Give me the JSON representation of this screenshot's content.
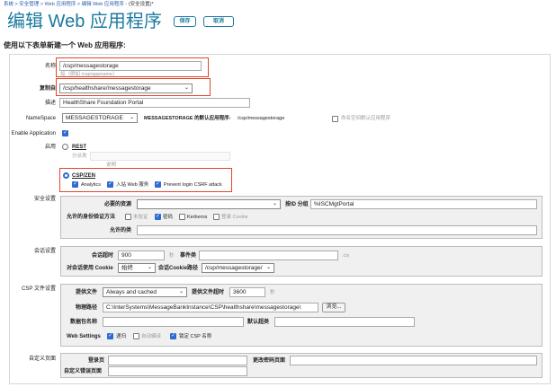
{
  "breadcrumb": {
    "items": [
      "系统",
      "安全管理",
      "Web 应用程序",
      "编辑 Web 应用程序"
    ],
    "current": "- (安全设置)*",
    "separator": ">"
  },
  "header": {
    "title": "编辑 Web 应用程序",
    "save_label": "保存",
    "cancel_label": "取消"
  },
  "subtitle": "使用以下表单新建一个 Web 应用程序:",
  "form": {
    "name_label": "名称",
    "name_value": "/csp/messagestorage",
    "name_hint": "如（例如 /csp/appname）",
    "copy_from_label": "复制自",
    "copy_from_value": "/csp/healthshare/messagestorage",
    "description_label": "描述",
    "description_value": "HealthShare Foundation Portal",
    "namespace_label": "NameSpace",
    "namespace_value": "MESSAGESTORAGE",
    "namespace_default_label": "MESSAGESTORAGE 的默认应用程序:",
    "namespace_default_value": "/csp/messagestorage",
    "namespace_default_checkbox": "命名空间默认应用程序",
    "enable_application_label": "Enable Application",
    "enable_label": "启用",
    "rest_label": "REST",
    "dispatch_class_label": "分派类",
    "dispatch_hint": "说明",
    "csp_zen_label": "CSP/ZEN",
    "analytics_label": "Analytics",
    "inbound_web_label": "入站 Web 服务",
    "csrf_label": "Prevent login CSRF attack"
  },
  "security": {
    "section_label": "安全设置",
    "required_resource_label": "必要的资源",
    "required_resource_value": "",
    "group_by_id_label": "按ID 分组",
    "group_by_id_value": "%ISCMgtPortal",
    "auth_methods_label": "允许的身份验证方法",
    "auth_options": [
      {
        "label": "未验证",
        "checked": false
      },
      {
        "label": "密码",
        "checked": true
      },
      {
        "label": "Kerberos",
        "checked": false
      },
      {
        "label": "登录 Cookie",
        "checked": false
      }
    ],
    "permitted_classes_label": "允许的类",
    "permitted_classes_value": ""
  },
  "session": {
    "section_label": "会话设置",
    "timeout_label": "会话超时",
    "timeout_value": "900",
    "timeout_unit": "秒",
    "event_class_label": "事件类",
    "event_class_value": "",
    "cls_suffix": ".cls",
    "use_cookie_label": "对会话使用 Cookie",
    "use_cookie_value": "始终",
    "cookie_path_label": "会话Cookie路径",
    "cookie_path_value": "/csp/messagestorage/"
  },
  "csp_files": {
    "section_label": "CSP 文件设置",
    "serve_files_label": "提供文件",
    "serve_files_value": "Always and cached",
    "serve_timeout_label": "提供文件超时",
    "serve_timeout_value": "3600",
    "serve_timeout_unit": "秒",
    "physical_path_label": "物理路径",
    "physical_path_value": "C:\\InterSystems\\MessageBankInstance\\CSP\\healthshare\\messagestorage\\",
    "browse_label": "浏览...",
    "package_name_label": "数据包名称",
    "package_name_value": "",
    "default_superclass_label": "默认超类",
    "default_superclass_value": "",
    "web_settings_label": "Web Settings",
    "web_options": [
      {
        "label": "递归",
        "checked": true
      },
      {
        "label": "自动编译",
        "checked": false
      },
      {
        "label": "锁定 CSP 名称",
        "checked": true
      }
    ]
  },
  "custom_pages": {
    "section_label": "自定义页面",
    "login_page_label": "登录页",
    "login_page_value": "",
    "change_password_label": "更改密码页面",
    "change_password_value": "",
    "custom_error_label": "自定义错误页面",
    "custom_error_value": ""
  },
  "colors": {
    "accent": "#1b7a9f",
    "highlight": "#e2452e",
    "checkbox": "#2f6bd1"
  }
}
